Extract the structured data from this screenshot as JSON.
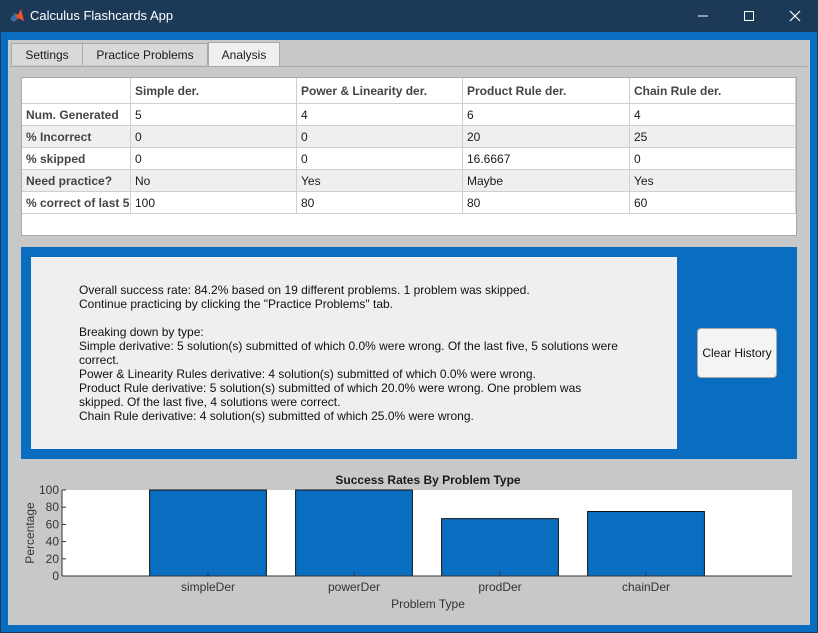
{
  "window": {
    "title": "Calculus Flashcards App"
  },
  "tabs": [
    {
      "label": "Settings",
      "active": false
    },
    {
      "label": "Practice Problems",
      "active": false
    },
    {
      "label": "Analysis",
      "active": true
    }
  ],
  "table": {
    "columns": [
      "",
      "Simple der.",
      "Power & Linearity der.",
      "Product Rule der.",
      "Chain Rule der."
    ],
    "rows": [
      [
        "Num. Generated",
        "5",
        "4",
        "6",
        "4"
      ],
      [
        "% Incorrect",
        "0",
        "0",
        "20",
        "25"
      ],
      [
        "% skipped",
        "0",
        "0",
        "16.6667",
        "0"
      ],
      [
        "Need practice?",
        "No",
        "Yes",
        "Maybe",
        "Yes"
      ],
      [
        "% correct of last 5",
        "100",
        "80",
        "80",
        "60"
      ]
    ]
  },
  "summary": {
    "lines": [
      "Overall success rate: 84.2% based on 19 different problems. 1 problem was skipped.",
      "Continue practicing by clicking the \"Practice Problems\" tab.",
      "",
      "Breaking down by type:",
      "Simple derivative: 5 solution(s) submitted of which 0.0% were wrong. Of the last five, 5 solutions were",
      "correct.",
      "Power & Linearity Rules derivative: 4 solution(s) submitted of which 0.0% were wrong.",
      "Product Rule derivative: 5 solution(s) submitted of which 20.0% were wrong. One problem was",
      "skipped. Of the last five, 4 solutions were correct.",
      "Chain Rule derivative: 4 solution(s) submitted of which 25.0% were wrong."
    ]
  },
  "clear_button": {
    "label": "Clear History"
  },
  "chart_data": {
    "type": "bar",
    "title": "Success Rates By Problem Type",
    "xlabel": "Problem Type",
    "ylabel": "Percentage",
    "categories": [
      "simpleDer",
      "powerDer",
      "prodDer",
      "chainDer"
    ],
    "values": [
      100,
      100,
      66.7,
      75
    ],
    "ylim": [
      0,
      100
    ],
    "yticks": [
      0,
      20,
      40,
      60,
      80,
      100
    ],
    "bar_color": "#0a6ec0"
  },
  "colors": {
    "accent": "#0a6ec0",
    "titlebar": "#1c3a57"
  }
}
